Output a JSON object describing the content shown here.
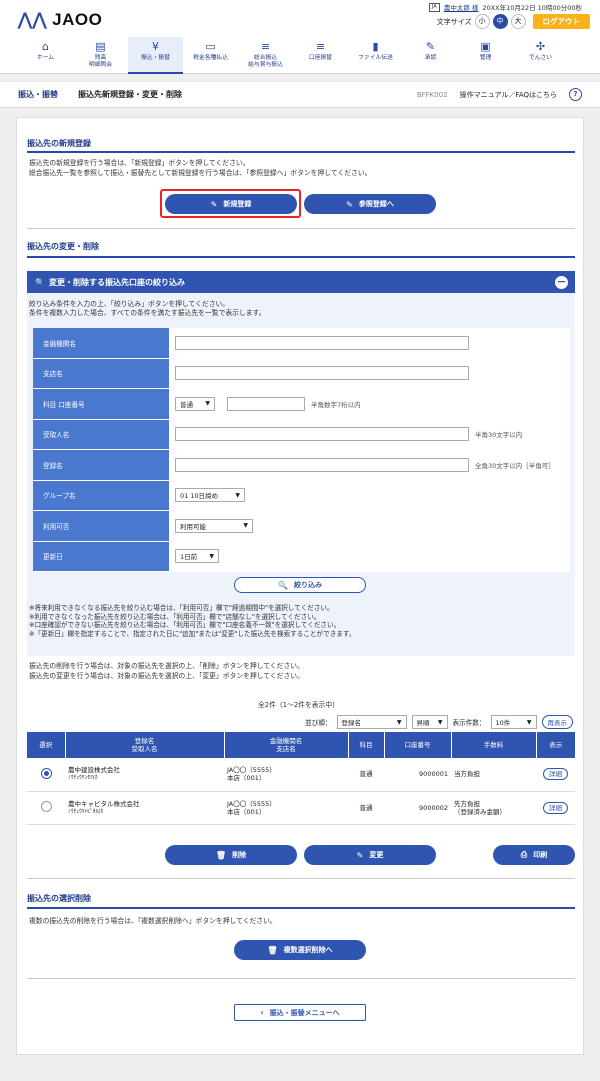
{
  "header": {
    "logo": "JAOO",
    "user_name": "農中太郎 様",
    "datetime": "20XX年10月22日 10時00分00秒",
    "font_size_label": "文字サイズ",
    "font_small": "小",
    "font_medium": "中",
    "font_large": "大",
    "logout": "ログアウト"
  },
  "nav": [
    {
      "label": "ホーム",
      "icon": "home-icon"
    },
    {
      "label": "残高\n明細照会",
      "icon": "passbook-icon"
    },
    {
      "label": "振込・振替",
      "icon": "yen-icon"
    },
    {
      "label": "税金各種払込",
      "icon": "payment-icon"
    },
    {
      "label": "総合振込\n給与賞与振込",
      "icon": "coins-icon"
    },
    {
      "label": "口座振替",
      "icon": "coins-icon"
    },
    {
      "label": "ファイル伝送",
      "icon": "file-icon"
    },
    {
      "label": "承認",
      "icon": "approve-icon"
    },
    {
      "label": "管理",
      "icon": "admin-icon"
    },
    {
      "label": "でんさい",
      "icon": "densai-icon"
    }
  ],
  "breadcrumb": {
    "category": "振込・振替",
    "title": "振込先新規登録・変更・削除",
    "screen_id": "BFFK002",
    "help": "操作マニュアル／FAQはこちら"
  },
  "new_reg": {
    "heading": "振込先の新規登録",
    "text1": "振込先の新規登録を行う場合は、「新規登録」ボタンを押してください。",
    "text2": "総合振込先一覧を参照して振込・振替先として新規登録を行う場合は、「参照登録へ」ボタンを押してください。",
    "btn_new": "新規登録",
    "btn_ref": "参照登録へ"
  },
  "change": {
    "heading": "振込先の変更・削除"
  },
  "filter": {
    "title": "変更・削除する振込先口座の絞り込み",
    "note1": "絞り込み条件を入力の上、「絞り込み」ボタンを押してください。",
    "note2": "条件を複数入力した場合、すべての条件を満たす振込先を一覧で表示します。",
    "rows": {
      "bank": "金融機関名",
      "branch": "支店名",
      "account": "科目 口座番号",
      "payee": "受取人名",
      "reg_name": "登録名",
      "group": "グループ名",
      "usable": "利用可否",
      "updated": "更新日"
    },
    "account_type": "普通",
    "account_hint": "半角数字7桁以内",
    "payee_hint": "半角30文字以内",
    "reg_hint": "全角30文字以内［半角可］",
    "group_value": "01 10日締め",
    "usable_value": "利用可能",
    "updated_value": "1日前",
    "btn": "絞り込み",
    "notes": [
      "※将来利用できなくなる振込先を絞り込む場合は、「利用可否」欄で\"経過期間中\"を選択してください。",
      "※利用できなくなった振込先を絞り込む場合は、「利用可否」欄で\"店舗なし\"を選択してください。",
      "※口座確認ができない振込先を絞り込む場合は、「利用可否」欄で\"口座名義不一致\"を選択してください。",
      "※「更新日」欄を指定することで、指定された日に\"追加\"または\"変更\"した振込先を検索することができます。"
    ]
  },
  "list_notes": [
    "振込先の削除を行う場合は、対象の振込先を選択の上、「削除」ボタンを押してください。",
    "振込先の変更を行う場合は、対象の振込先を選択の上、「変更」ボタンを押してください。"
  ],
  "list": {
    "count": "全2件（1〜2件を表示中）",
    "sort_label": "並び順：",
    "sort_value": "登録名",
    "order_value": "昇順",
    "per_page_label": "表示件数：",
    "per_page_value": "10件",
    "redisplay": "再表示",
    "headers": {
      "select": "選択",
      "name": "登録名\n受取人名",
      "bank": "金融機関名\n支店名",
      "type": "科目",
      "acct": "口座番号",
      "fee": "手数料",
      "detail": "表示"
    },
    "rows": [
      {
        "selected": true,
        "name": "農中建設株式会社",
        "kana": "ﾉｳﾁｭｳｹﾝｾﾂ(ｶ",
        "bank": "JA〇〇（5555）",
        "branch": "本店（001）",
        "type": "普通",
        "acct": "9000001",
        "fee": "当方負担",
        "fee2": "",
        "detail": "詳細"
      },
      {
        "selected": false,
        "name": "農中キャピタル株式会社",
        "kana": "ﾉｳﾁｭｳｷｬﾋﾟﾀﾙ(ｶ",
        "bank": "JA〇〇（5555）",
        "branch": "本店（001）",
        "type": "普通",
        "acct": "9000002",
        "fee": "先方負担",
        "fee2": "（登録済み金額）",
        "detail": "詳細"
      }
    ],
    "btn_delete": "削除",
    "btn_change": "変更",
    "btn_print": "印刷"
  },
  "multi": {
    "heading": "振込先の選択削除",
    "text": "複数の振込先の削除を行う場合は、「複数選択削除へ」ボタンを押してください。",
    "btn": "複数選択削除へ"
  },
  "back": "振込・振替メニューへ"
}
